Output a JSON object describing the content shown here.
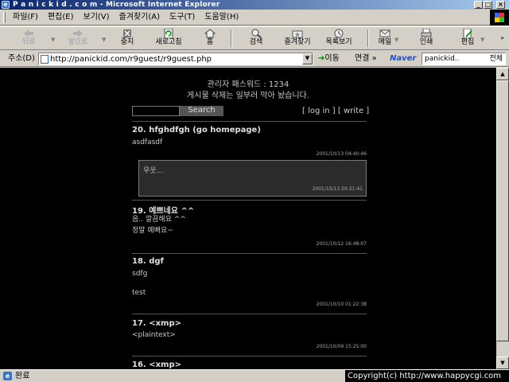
{
  "window": {
    "title": "P a n i c k i d . c o m - Microsoft Internet Explorer"
  },
  "menu": [
    "파일(F)",
    "편집(E)",
    "보기(V)",
    "즐겨찾기(A)",
    "도구(T)",
    "도움말(H)"
  ],
  "toolbar": {
    "back": "뒤로",
    "forward": "앞으로",
    "stop": "중지",
    "refresh": "새로고침",
    "home": "홈",
    "search": "검색",
    "favorites": "즐겨찾기",
    "history": "목록보기",
    "mail": "메일",
    "print": "인쇄",
    "edit": "편집"
  },
  "address": {
    "label": "주소(D)",
    "url": "http://panickid.com/r9guest/r9guest.php",
    "go": "이동",
    "links": "연결",
    "naver_logo": "Naver",
    "naver_query": "panickid..",
    "naver_scope": "전체"
  },
  "page": {
    "admin_pw": "관리자 패스워드 : 1234",
    "notice": "게시물 삭제는 일부러 막아 놨습니다.",
    "search_button": "Search",
    "login_link": "[ log in ]",
    "write_link": "[ write ]",
    "posts": [
      {
        "title": "20. hfghdfgh (go homepage)",
        "lines": [
          "asdfasdf"
        ],
        "date": "2001/10/13 04:40:46",
        "reply": {
          "text": "우웃...",
          "date": "2001/10/13 20:21:41"
        }
      },
      {
        "title": "19. 예쁘네요 ^^",
        "lines": [
          "음.. 깔끔해요 ^^",
          "정말 예뻐요~"
        ],
        "date": "2001/10/12 16:48:07"
      },
      {
        "title": "18. dgf",
        "lines": [
          "sdfg",
          "",
          "test"
        ],
        "date": "2001/10/10 01:22:38"
      },
      {
        "title": "17. <xmp>",
        "lines": [
          "<plaintext>"
        ],
        "date": "2001/10/09 15:25:00"
      },
      {
        "title": "16. <xmp>",
        "lines": [],
        "date": ""
      }
    ]
  },
  "status": {
    "text": "완료",
    "copyright": "Copyright(c) http://www.happycgi.com"
  }
}
